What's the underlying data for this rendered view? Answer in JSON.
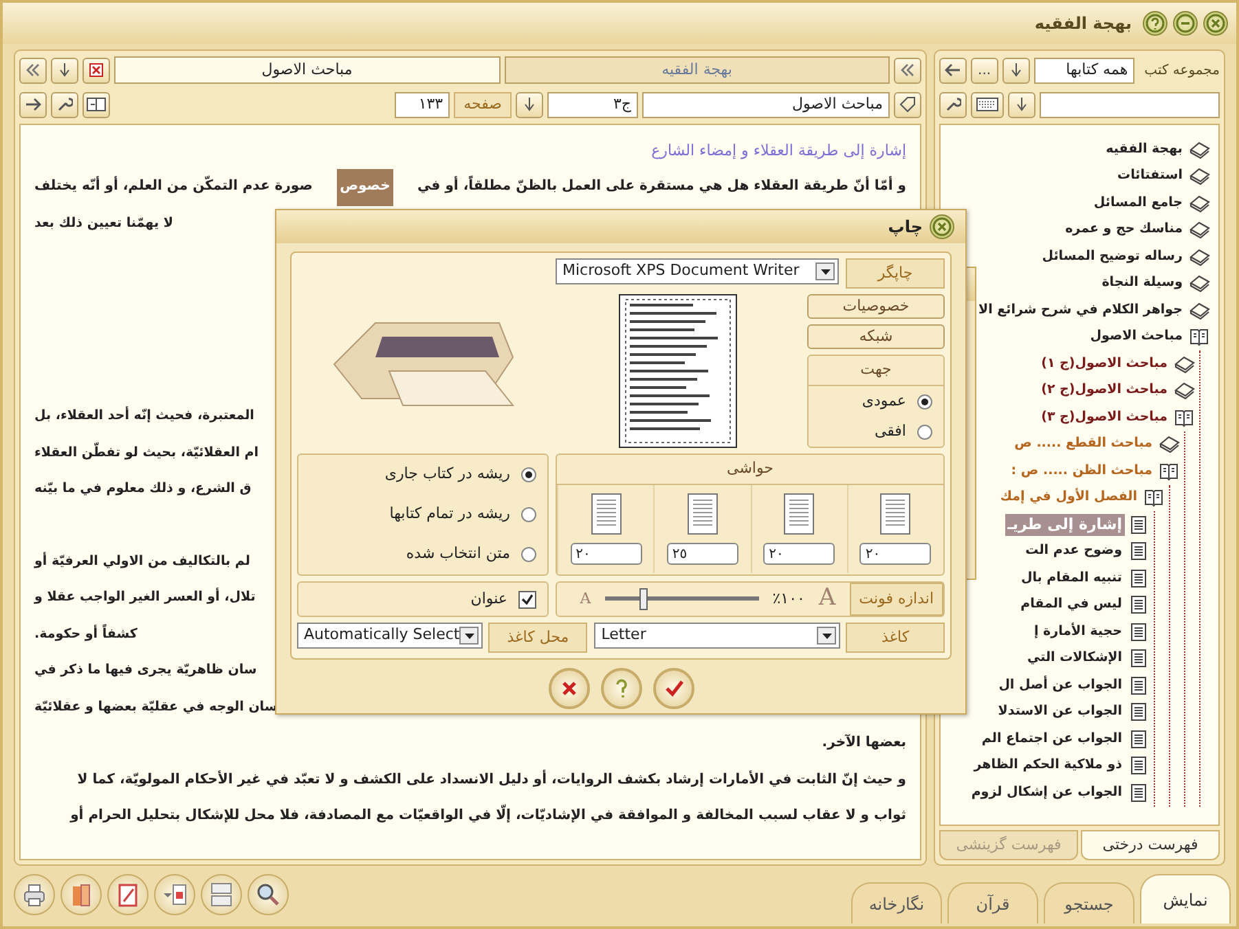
{
  "window": {
    "title": "بهجة الفقيه"
  },
  "reader": {
    "tabs": [
      {
        "label": "بهجة الفقيه",
        "selected": false
      },
      {
        "label": "مباحث الاصول",
        "selected": true
      }
    ],
    "book_field": "مباحث الاصول",
    "volume_field": "ج٣",
    "page_label": "صفحه",
    "page_field": "١٣٣",
    "heading": "إشارة إلى طريقة العقلاء و إمضاء الشارع",
    "paragraphs": [
      {
        "lines": [
          {
            "kind": "full",
            "segments": [
              {
                "text": "و أمّا أنّ طريقة العقلاء هل هي مستقرة على العمل بالظنّ مطلقاً، أو في",
                "highlighted": false
              },
              {
                "text": "خصوص",
                "highlighted": true
              },
              {
                "text": "صورة عدم التمكّن من العلم، أو أنّه يختلف",
                "highlighted": false
              }
            ]
          },
          {
            "kind": "fragment",
            "segments": [
              {
                "text": "لا يهمّنا تعيين ذلك بعد",
                "highlighted": false
              }
            ]
          }
        ]
      },
      {
        "lines": [
          {
            "kind": "fragment",
            "segments": [
              {
                "text": "المعتبرة، فحيث إنّه أحد العقلاء، بل",
                "highlighted": false
              }
            ]
          },
          {
            "kind": "fragment",
            "segments": [
              {
                "text": "ام العقلائيّة، بحيث لو تفطّن العقلاء",
                "highlighted": false
              }
            ]
          },
          {
            "kind": "fragment",
            "segments": [
              {
                "text": "ق الشرع، و ذلك معلوم في ما بيّنه",
                "highlighted": false
              }
            ]
          }
        ]
      },
      {
        "lines": [
          {
            "kind": "fragment",
            "segments": [
              {
                "text": "لم بالتكاليف من الاولي العرفيّة أو",
                "highlighted": false
              }
            ]
          },
          {
            "kind": "fragment",
            "segments": [
              {
                "text": "تلال، أو العسر الغير الواجب عقلا و",
                "highlighted": false
              }
            ]
          },
          {
            "kind": "fragment",
            "segments": [
              {
                "text": "كشفاً أو حكومة.",
                "highlighted": false
              }
            ]
          },
          {
            "kind": "fragment",
            "segments": [
              {
                "text": "سان ظاهريّة يجرى فيها ما ذكر في",
                "highlighted": false
              }
            ]
          },
          {
            "kind": "fragment",
            "segments": [
              {
                "text": "سان الوجه في عقليّة بعضها و عقلائيّة",
                "highlighted": false
              }
            ]
          },
          {
            "kind": "end",
            "segments": [
              {
                "text": "بعضها الآخر.",
                "highlighted": false
              }
            ]
          }
        ]
      },
      {
        "lines": [
          {
            "kind": "full",
            "segments": [
              {
                "text": "و حيث إنّ الثابت في الأمارات إرشاد بكشف الروايات، أو دليل الانسداد على الكشف و لا تعبّد في غير الأحكام المولويّة، كما لا",
                "highlighted": false
              }
            ]
          },
          {
            "kind": "full",
            "segments": [
              {
                "text": "ثواب و لا عقاب لسبب المخالفة و الموافقة في الإشاديّات، إلّا في الواقعيّات مع المصادفة، فلا محل للإشكال بتحليل الحرام أو",
                "highlighted": false
              }
            ]
          }
        ]
      }
    ]
  },
  "library": {
    "collection_label": "مجموعه كتب",
    "collection": "همه كتابها",
    "more_button": "...",
    "tree": [
      {
        "label": "بهجة الفقيه",
        "kind": "book",
        "selected": false
      },
      {
        "label": "استفتائات",
        "kind": "book",
        "selected": false
      },
      {
        "label": "جامع المسائل",
        "kind": "book",
        "selected": false
      },
      {
        "label": "مناسك حج و عمره",
        "kind": "book",
        "selected": false
      },
      {
        "label": "رساله توضيح المسائل",
        "kind": "book",
        "selected": false
      },
      {
        "label": "وسيلة النجاة",
        "kind": "book",
        "selected": false
      },
      {
        "label": "جواهر الكلام في شرح شرائع الا",
        "kind": "book",
        "selected": false
      },
      {
        "label": "مباحث الاصول",
        "kind": "open",
        "selected": false,
        "children": [
          {
            "label": "مباحث الاصول(ج ١)",
            "kind": "book",
            "selected": false
          },
          {
            "label": "مباحث الاصول(ج ٢)",
            "kind": "book",
            "selected": false
          },
          {
            "label": "مباحث الاصول(ج ٣)",
            "kind": "open",
            "selected": false,
            "children": [
              {
                "label": "مباحث القطع ..... ص",
                "kind": "book",
                "selected": false
              },
              {
                "label": "مباحث الظن ..... ص :",
                "kind": "open",
                "selected": false,
                "children": [
                  {
                    "label": "الفصل الأول في إمك",
                    "kind": "open",
                    "selected": false,
                    "children": [
                      {
                        "label": "إشارة إلى طريـ",
                        "kind": "page",
                        "selected": true
                      },
                      {
                        "label": "وضوح عدم الت",
                        "kind": "page",
                        "selected": false
                      },
                      {
                        "label": "تنبيه المقام بال",
                        "kind": "page",
                        "selected": false
                      },
                      {
                        "label": "ليس في المقام",
                        "kind": "page",
                        "selected": false
                      },
                      {
                        "label": "حجية الأمارة إ",
                        "kind": "page",
                        "selected": false
                      },
                      {
                        "label": "الإشكالات التي",
                        "kind": "page",
                        "selected": false
                      },
                      {
                        "label": "الجواب عن أصل ال",
                        "kind": "page",
                        "selected": false
                      },
                      {
                        "label": "الجواب عن الاستدلا",
                        "kind": "page",
                        "selected": false
                      },
                      {
                        "label": "الجواب عن اجتماع الم",
                        "kind": "page",
                        "selected": false
                      },
                      {
                        "label": "ذو ملاكية الحكم الظاهر",
                        "kind": "page",
                        "selected": false
                      },
                      {
                        "label": "الجواب عن إشكال لزوم",
                        "kind": "page",
                        "selected": false
                      }
                    ]
                  }
                ]
              }
            ]
          }
        ]
      }
    ],
    "tabs": [
      {
        "label": "فهرست درختی",
        "selected": true
      },
      {
        "label": "فهرست گزینشی",
        "selected": false
      }
    ]
  },
  "bottom_tabs": [
    {
      "label": "نمایش",
      "selected": true
    },
    {
      "label": "جستجو",
      "selected": false
    },
    {
      "label": "قرآن",
      "selected": false
    },
    {
      "label": "نگارخانه",
      "selected": false
    }
  ],
  "print_dialog": {
    "title": "چاپ",
    "printer_label": "چاپگر",
    "printer": "Microsoft XPS Document Writer",
    "buttons": [
      "خصوصيات",
      "شبكه"
    ],
    "orientation": {
      "label": "جهت",
      "options": [
        {
          "label": "عمودی",
          "selected": true
        },
        {
          "label": "افقی",
          "selected": false
        }
      ]
    },
    "margins": {
      "label": "حواشی",
      "values": [
        "٢٠",
        "٢٠",
        "٢٥",
        "٢٠"
      ]
    },
    "scope": [
      {
        "label": "ريشه در كتاب جاری",
        "selected": true
      },
      {
        "label": "ريشه در تمام كتابها",
        "selected": false
      },
      {
        "label": "متن انتخاب شده",
        "selected": false
      }
    ],
    "title_option": {
      "label": "عنوان",
      "checked": true
    },
    "font_size": {
      "label": "اندازه فونت",
      "large_glyph": "A",
      "reading": "١٠٠٪",
      "level": 0.25,
      "small_glyph": "A"
    },
    "paper": {
      "label": "کاغذ",
      "value": "Letter"
    },
    "paper_source": {
      "label": "محل کاغذ",
      "value": "Automatically Select"
    }
  }
}
